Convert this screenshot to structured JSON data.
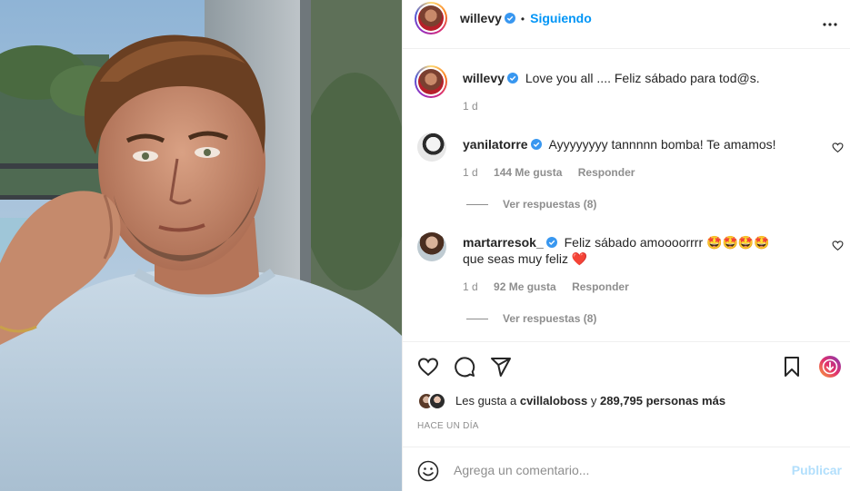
{
  "header": {
    "username": "willevy",
    "separator": "•",
    "follow_state": "Siguiendo"
  },
  "caption": {
    "username": "willevy",
    "text": "Love you all .... Feliz sábado para tod@s.",
    "time": "1 d"
  },
  "comments": [
    {
      "username": "yanilatorre",
      "text": "Ayyyyyyyy tannnnn bomba! Te amamos!",
      "time": "1 d",
      "likes": "144 Me gusta",
      "reply_label": "Responder",
      "view_replies": "Ver respuestas (8)"
    },
    {
      "username": "martarresok_",
      "text": "Feliz sábado amoooorrrr 🤩🤩🤩🤩 que seas muy feliz ❤️",
      "time": "1 d",
      "likes": "92 Me gusta",
      "reply_label": "Responder",
      "view_replies": "Ver respuestas (8)"
    }
  ],
  "likes": {
    "prefix": "Les gusta a",
    "user": "cvillaloboss",
    "connector": "y",
    "count": "289,795 personas más"
  },
  "timestamp": "HACE UN DÍA",
  "composer": {
    "placeholder": "Agrega un comentario...",
    "post_label": "Publicar"
  },
  "colors": {
    "accent": "#0095f6",
    "verified": "#3897f0",
    "muted": "#8e8e8e",
    "post_disabled": "#b2dffc"
  },
  "icons": [
    "more-icon",
    "verified-icon",
    "heart-icon",
    "comment-icon",
    "share-icon",
    "bookmark-icon",
    "boost-icon",
    "emoji-icon"
  ]
}
